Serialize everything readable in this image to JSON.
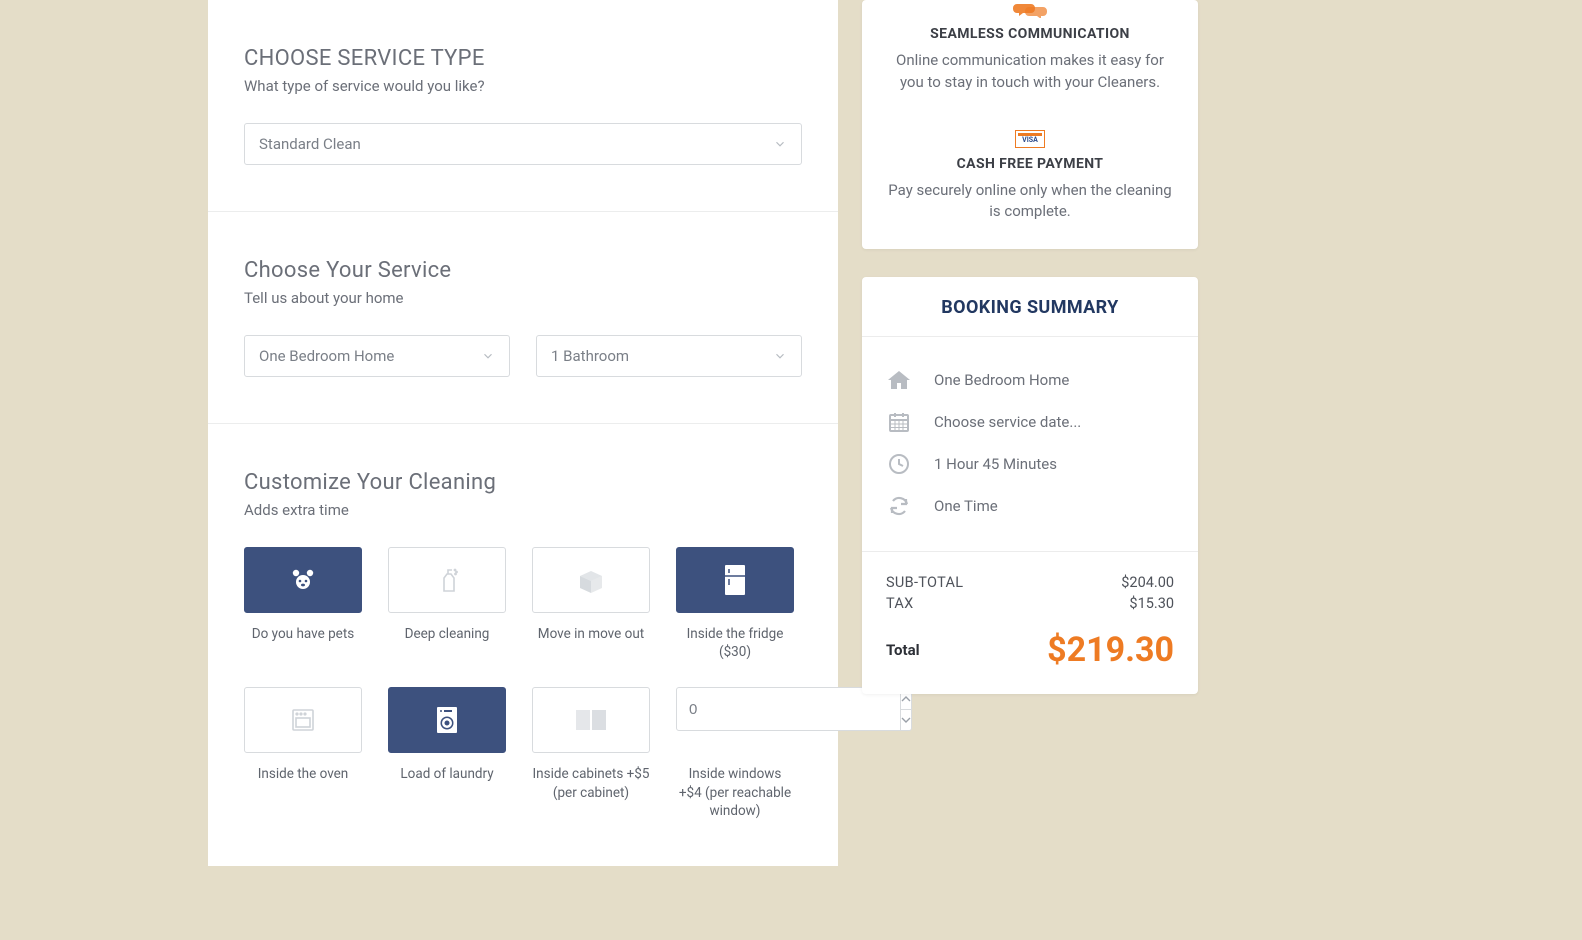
{
  "service_type": {
    "title": "CHOOSE SERVICE TYPE",
    "subtitle": "What type of service would you like?",
    "selected": "Standard Clean"
  },
  "your_service": {
    "title": "Choose Your Service",
    "subtitle": "Tell us about your home",
    "bedrooms": "One Bedroom Home",
    "bathrooms": "1 Bathroom"
  },
  "customize": {
    "title": "Customize Your Cleaning",
    "subtitle": "Adds extra time",
    "options": [
      {
        "label": "Do you have pets",
        "selected": true
      },
      {
        "label": "Deep cleaning",
        "selected": false
      },
      {
        "label": "Move in move out",
        "selected": false
      },
      {
        "label": "Inside the fridge ($30)",
        "selected": true
      },
      {
        "label": "Inside the oven",
        "selected": false
      },
      {
        "label": "Load of laundry",
        "selected": true
      },
      {
        "label": "Inside cabinets +$5 (per cabinet)",
        "selected": false
      },
      {
        "label": "Inside windows +$4 (per reachable window)",
        "selected": false
      }
    ],
    "windows_qty": "0"
  },
  "promos": [
    {
      "title": "SEAMLESS COMMUNICATION",
      "text": "Online communication makes it easy for you to stay in touch with your Cleaners."
    },
    {
      "title": "CASH FREE PAYMENT",
      "text": "Pay securely online only when the cleaning is complete."
    }
  ],
  "summary": {
    "heading": "BOOKING SUMMARY",
    "home": "One Bedroom Home",
    "date": "Choose service date...",
    "duration": "1 Hour 45 Minutes",
    "frequency": "One Time",
    "subtotal_label": "SUB-TOTAL",
    "subtotal_value": "$204.00",
    "tax_label": "TAX",
    "tax_value": "$15.30",
    "total_label": "Total",
    "total_value": "$219.30"
  }
}
